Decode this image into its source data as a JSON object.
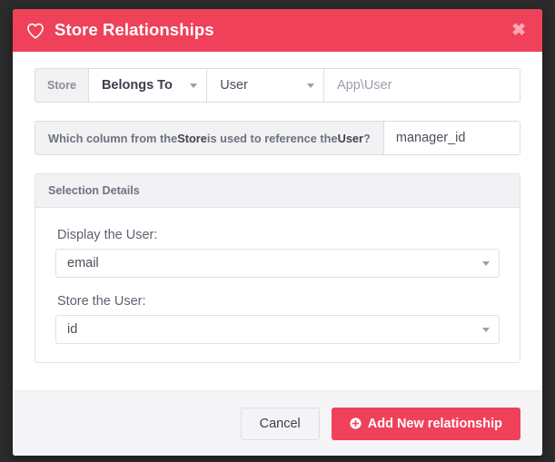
{
  "modal": {
    "title": "Store Relationships",
    "icons": {
      "title_icon": "heart-outline-icon",
      "close_icon": "close-icon",
      "close_glyph": "✖",
      "caret_icon": "chevron-down-icon",
      "plus_circle_icon": "plus-circle-icon"
    },
    "colors": {
      "accent": "#ef4159",
      "accent_text": "#ffffff",
      "close": "#f9a8b4",
      "panel_header_bg": "#f2f2f4",
      "footer_bg": "#f5f5f7",
      "border": "#dcdde1",
      "overlay": "#2b2b2b"
    }
  },
  "relationship_row": {
    "addon_label": "Store",
    "type_select": {
      "value": "Belongs To"
    },
    "model_select": {
      "value": "User"
    },
    "class_input": {
      "value": "",
      "placeholder": "App\\User"
    }
  },
  "question_row": {
    "prefix": "Which column from the ",
    "strong_one": "Store",
    "middle": " is used to reference the ",
    "strong_two": "User",
    "suffix": "?",
    "column_select": {
      "value": "manager_id"
    }
  },
  "panel": {
    "heading": "Selection Details",
    "fields": [
      {
        "label": "Display the User:",
        "value": "email"
      },
      {
        "label": "Store the User:",
        "value": "id"
      }
    ]
  },
  "footer": {
    "cancel_label": "Cancel",
    "submit_label": "Add New relationship"
  }
}
